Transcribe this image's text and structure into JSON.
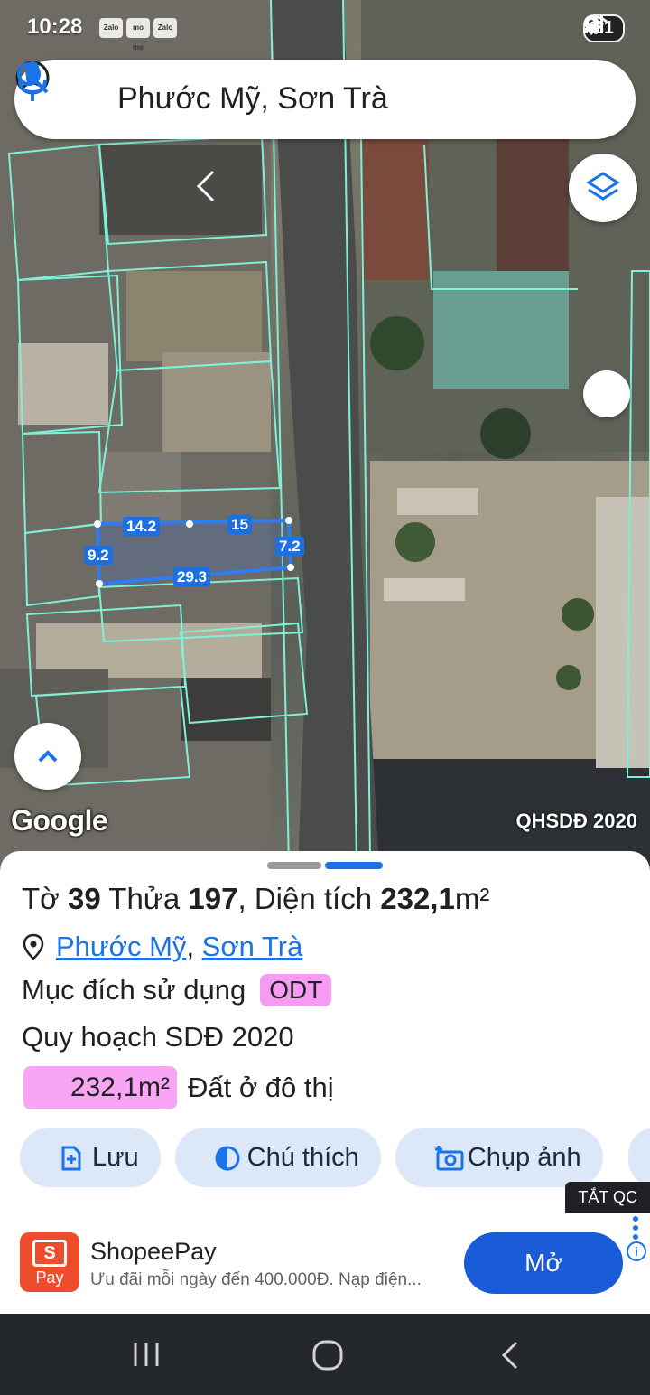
{
  "status_bar": {
    "time": "10:28",
    "apps": [
      "Zalo",
      "mo mo",
      "Zalo"
    ],
    "battery": "81"
  },
  "search": {
    "query": "Phước Mỹ, Sơn Trà"
  },
  "map": {
    "watermark": "Google",
    "layer_label": "QHSDĐ 2020",
    "dimensions": [
      "14.2",
      "15",
      "9.2",
      "7.2",
      "29.3"
    ]
  },
  "parcel": {
    "to_label": "Tờ",
    "to_value": "39",
    "thua_label": "Thửa",
    "thua_value": "197",
    "area_label": ", Diện tích",
    "area_value": "232,1",
    "area_unit": "m²",
    "ward": "Phước Mỹ",
    "district": "Sơn Trà",
    "purpose_label": "Mục đích sử dụng",
    "purpose_code": "ODT",
    "plan_label": "Quy hoạch SDĐ 2020",
    "plan_area": "232,1m²",
    "plan_use": "Đất ở đô thị",
    "colors": {
      "odt_badge": "#f59bf2",
      "area_chip": "#f8a5f4"
    }
  },
  "actions": [
    {
      "label": "Lưu",
      "icon": "bookmark-add-icon"
    },
    {
      "label": "Chú thích",
      "icon": "contrast-icon"
    },
    {
      "label": "Chụp ảnh",
      "icon": "camera-add-icon"
    }
  ],
  "ad": {
    "close_label": "TẮT QC",
    "logo_text": "Pay",
    "logo_letter": "S",
    "title": "ShopeePay",
    "description": "Ưu đãi mỗi ngày đến 400.000Đ. Nạp điện...",
    "cta": "Mở",
    "info": "i"
  },
  "accent_color": "#1a73e8"
}
